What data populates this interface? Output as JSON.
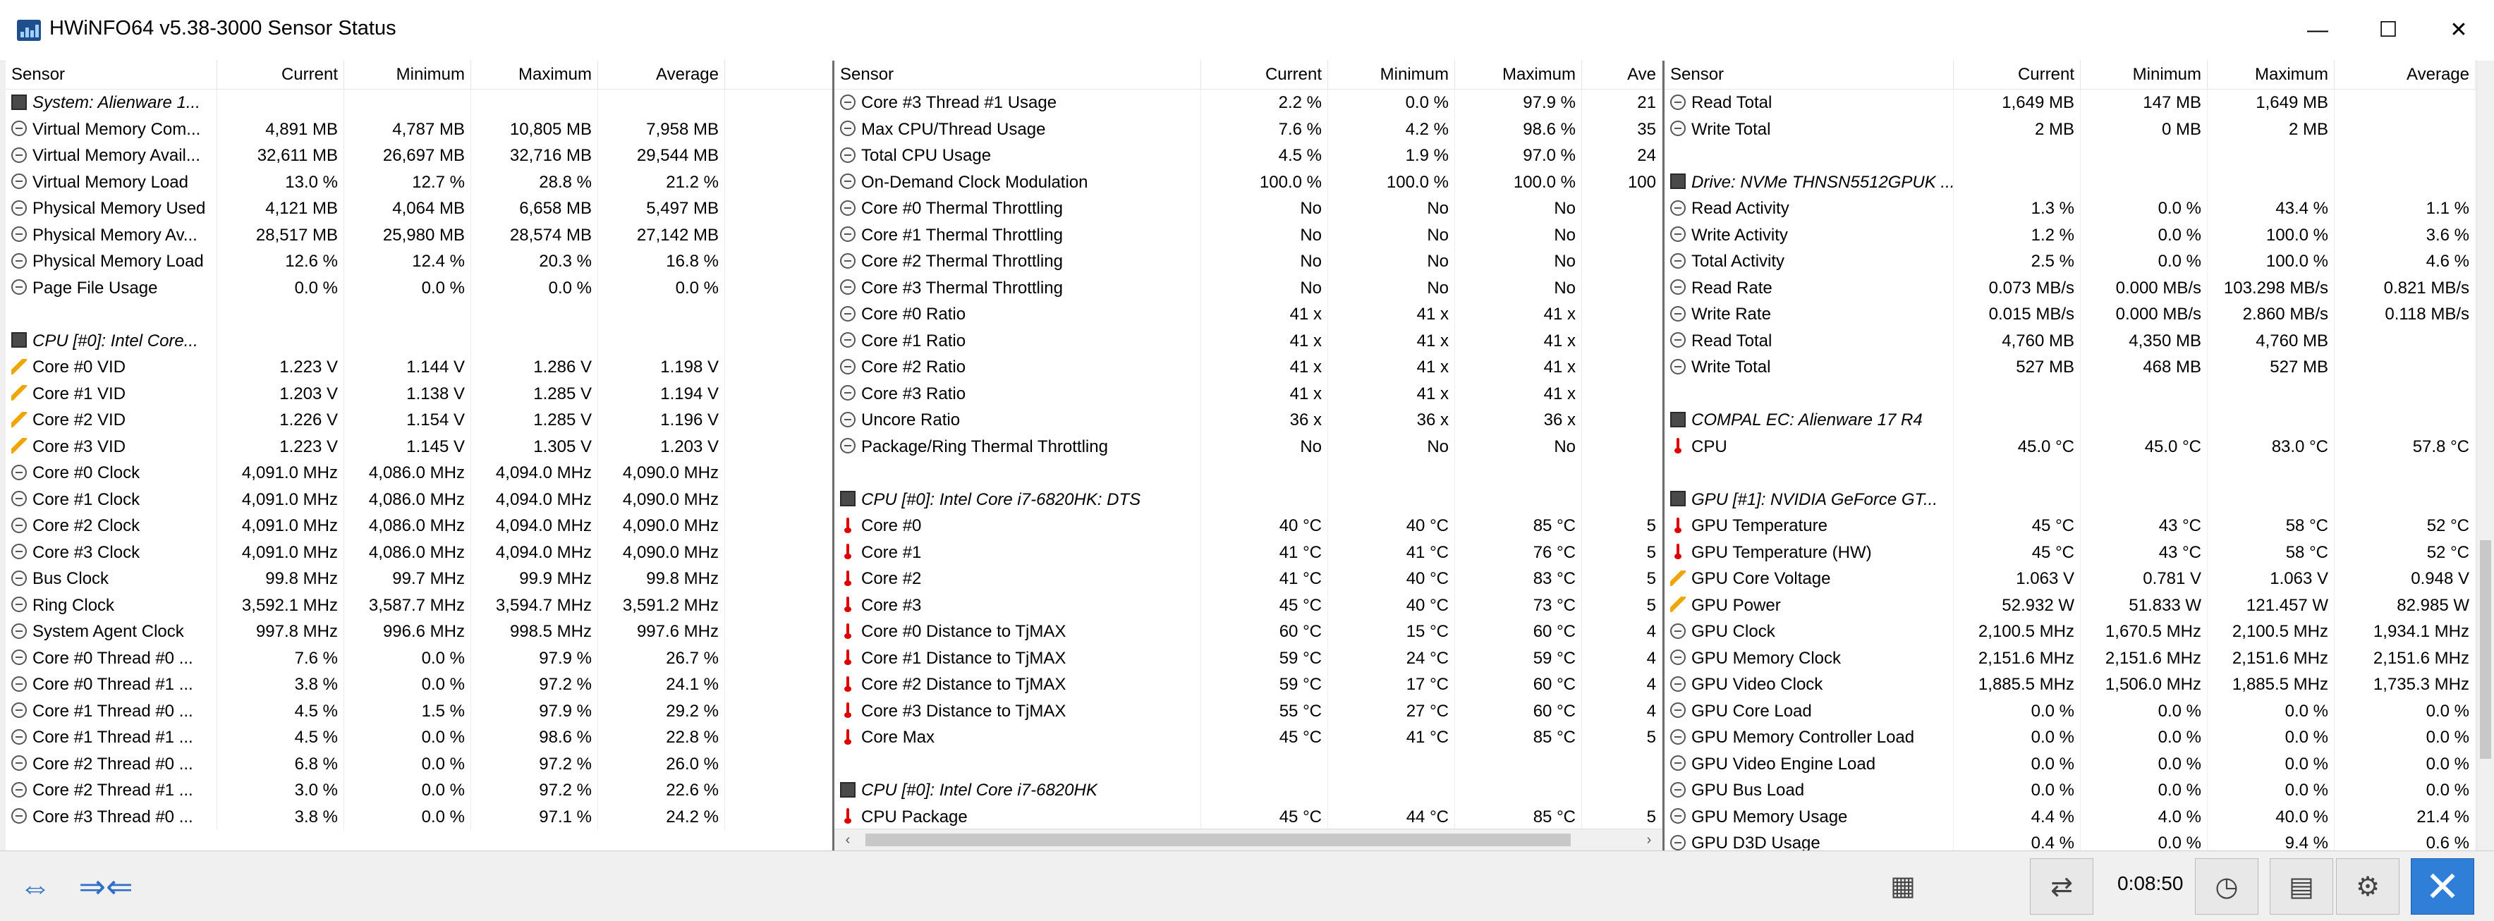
{
  "window": {
    "title": "HWiNFO64 v5.38-3000 Sensor Status",
    "min": "—",
    "max": "☐",
    "close": "✕"
  },
  "panel1": {
    "headers": [
      "Sensor",
      "Current",
      "Minimum",
      "Maximum",
      "Average"
    ],
    "rows": [
      {
        "icon": "chip",
        "name": "System: Alienware 1...",
        "group": true,
        "v": [
          "",
          "",
          "",
          ""
        ]
      },
      {
        "icon": "sensor",
        "name": "Virtual Memory Com...",
        "v": [
          "4,891 MB",
          "4,787 MB",
          "10,805 MB",
          "7,958 MB"
        ]
      },
      {
        "icon": "sensor",
        "name": "Virtual Memory Avail...",
        "v": [
          "32,611 MB",
          "26,697 MB",
          "32,716 MB",
          "29,544 MB"
        ]
      },
      {
        "icon": "sensor",
        "name": "Virtual Memory Load",
        "v": [
          "13.0 %",
          "12.7 %",
          "28.8 %",
          "21.2 %"
        ]
      },
      {
        "icon": "sensor",
        "name": "Physical Memory Used",
        "v": [
          "4,121 MB",
          "4,064 MB",
          "6,658 MB",
          "5,497 MB"
        ]
      },
      {
        "icon": "sensor",
        "name": "Physical Memory Av...",
        "v": [
          "28,517 MB",
          "25,980 MB",
          "28,574 MB",
          "27,142 MB"
        ]
      },
      {
        "icon": "sensor",
        "name": "Physical Memory Load",
        "v": [
          "12.6 %",
          "12.4 %",
          "20.3 %",
          "16.8 %"
        ]
      },
      {
        "icon": "sensor",
        "name": "Page File Usage",
        "v": [
          "0.0 %",
          "0.0 %",
          "0.0 %",
          "0.0 %"
        ]
      },
      {
        "icon": "",
        "name": "",
        "v": [
          "",
          "",
          "",
          ""
        ]
      },
      {
        "icon": "chip",
        "name": "CPU [#0]: Intel Core...",
        "group": true,
        "v": [
          "",
          "",
          "",
          ""
        ]
      },
      {
        "icon": "volt",
        "name": "Core #0 VID",
        "v": [
          "1.223 V",
          "1.144 V",
          "1.286 V",
          "1.198 V"
        ]
      },
      {
        "icon": "volt",
        "name": "Core #1 VID",
        "v": [
          "1.203 V",
          "1.138 V",
          "1.285 V",
          "1.194 V"
        ]
      },
      {
        "icon": "volt",
        "name": "Core #2 VID",
        "v": [
          "1.226 V",
          "1.154 V",
          "1.285 V",
          "1.196 V"
        ]
      },
      {
        "icon": "volt",
        "name": "Core #3 VID",
        "v": [
          "1.223 V",
          "1.145 V",
          "1.305 V",
          "1.203 V"
        ]
      },
      {
        "icon": "sensor",
        "name": "Core #0 Clock",
        "v": [
          "4,091.0 MHz",
          "4,086.0 MHz",
          "4,094.0 MHz",
          "4,090.0 MHz"
        ]
      },
      {
        "icon": "sensor",
        "name": "Core #1 Clock",
        "v": [
          "4,091.0 MHz",
          "4,086.0 MHz",
          "4,094.0 MHz",
          "4,090.0 MHz"
        ]
      },
      {
        "icon": "sensor",
        "name": "Core #2 Clock",
        "v": [
          "4,091.0 MHz",
          "4,086.0 MHz",
          "4,094.0 MHz",
          "4,090.0 MHz"
        ]
      },
      {
        "icon": "sensor",
        "name": "Core #3 Clock",
        "v": [
          "4,091.0 MHz",
          "4,086.0 MHz",
          "4,094.0 MHz",
          "4,090.0 MHz"
        ]
      },
      {
        "icon": "sensor",
        "name": "Bus Clock",
        "v": [
          "99.8 MHz",
          "99.7 MHz",
          "99.9 MHz",
          "99.8 MHz"
        ]
      },
      {
        "icon": "sensor",
        "name": "Ring Clock",
        "v": [
          "3,592.1 MHz",
          "3,587.7 MHz",
          "3,594.7 MHz",
          "3,591.2 MHz"
        ]
      },
      {
        "icon": "sensor",
        "name": "System Agent Clock",
        "v": [
          "997.8 MHz",
          "996.6 MHz",
          "998.5 MHz",
          "997.6 MHz"
        ]
      },
      {
        "icon": "sensor",
        "name": "Core #0 Thread #0 ...",
        "v": [
          "7.6 %",
          "0.0 %",
          "97.9 %",
          "26.7 %"
        ]
      },
      {
        "icon": "sensor",
        "name": "Core #0 Thread #1 ...",
        "v": [
          "3.8 %",
          "0.0 %",
          "97.2 %",
          "24.1 %"
        ]
      },
      {
        "icon": "sensor",
        "name": "Core #1 Thread #0 ...",
        "v": [
          "4.5 %",
          "1.5 %",
          "97.9 %",
          "29.2 %"
        ]
      },
      {
        "icon": "sensor",
        "name": "Core #1 Thread #1 ...",
        "v": [
          "4.5 %",
          "0.0 %",
          "98.6 %",
          "22.8 %"
        ]
      },
      {
        "icon": "sensor",
        "name": "Core #2 Thread #0 ...",
        "v": [
          "6.8 %",
          "0.0 %",
          "97.2 %",
          "26.0 %"
        ]
      },
      {
        "icon": "sensor",
        "name": "Core #2 Thread #1 ...",
        "v": [
          "3.0 %",
          "0.0 %",
          "97.2 %",
          "22.6 %"
        ]
      },
      {
        "icon": "sensor",
        "name": "Core #3 Thread #0 ...",
        "v": [
          "3.8 %",
          "0.0 %",
          "97.1 %",
          "24.2 %"
        ]
      }
    ]
  },
  "panel2": {
    "headers": [
      "Sensor",
      "Current",
      "Minimum",
      "Maximum",
      "Ave"
    ],
    "rows": [
      {
        "icon": "sensor",
        "name": "Core #3 Thread #1 Usage",
        "v": [
          "2.2 %",
          "0.0 %",
          "97.9 %",
          "21"
        ]
      },
      {
        "icon": "sensor",
        "name": "Max CPU/Thread Usage",
        "v": [
          "7.6 %",
          "4.2 %",
          "98.6 %",
          "35"
        ]
      },
      {
        "icon": "sensor",
        "name": "Total CPU Usage",
        "v": [
          "4.5 %",
          "1.9 %",
          "97.0 %",
          "24"
        ]
      },
      {
        "icon": "sensor",
        "name": "On-Demand Clock Modulation",
        "v": [
          "100.0 %",
          "100.0 %",
          "100.0 %",
          "100"
        ]
      },
      {
        "icon": "sensor",
        "name": "Core #0 Thermal Throttling",
        "v": [
          "No",
          "No",
          "No",
          ""
        ]
      },
      {
        "icon": "sensor",
        "name": "Core #1 Thermal Throttling",
        "v": [
          "No",
          "No",
          "No",
          ""
        ]
      },
      {
        "icon": "sensor",
        "name": "Core #2 Thermal Throttling",
        "v": [
          "No",
          "No",
          "No",
          ""
        ]
      },
      {
        "icon": "sensor",
        "name": "Core #3 Thermal Throttling",
        "v": [
          "No",
          "No",
          "No",
          ""
        ]
      },
      {
        "icon": "sensor",
        "name": "Core #0 Ratio",
        "v": [
          "41 x",
          "41 x",
          "41 x",
          ""
        ]
      },
      {
        "icon": "sensor",
        "name": "Core #1 Ratio",
        "v": [
          "41 x",
          "41 x",
          "41 x",
          ""
        ]
      },
      {
        "icon": "sensor",
        "name": "Core #2 Ratio",
        "v": [
          "41 x",
          "41 x",
          "41 x",
          ""
        ]
      },
      {
        "icon": "sensor",
        "name": "Core #3 Ratio",
        "v": [
          "41 x",
          "41 x",
          "41 x",
          ""
        ]
      },
      {
        "icon": "sensor",
        "name": "Uncore Ratio",
        "v": [
          "36 x",
          "36 x",
          "36 x",
          ""
        ]
      },
      {
        "icon": "sensor",
        "name": "Package/Ring Thermal Throttling",
        "v": [
          "No",
          "No",
          "No",
          ""
        ]
      },
      {
        "icon": "",
        "name": "",
        "v": [
          "",
          "",
          "",
          ""
        ]
      },
      {
        "icon": "chip",
        "name": "CPU [#0]: Intel Core i7-6820HK: DTS",
        "group": true,
        "v": [
          "",
          "",
          "",
          ""
        ]
      },
      {
        "icon": "temp",
        "name": "Core #0",
        "v": [
          "40 °C",
          "40 °C",
          "85 °C",
          "5"
        ]
      },
      {
        "icon": "temp",
        "name": "Core #1",
        "v": [
          "41 °C",
          "41 °C",
          "76 °C",
          "5"
        ]
      },
      {
        "icon": "temp",
        "name": "Core #2",
        "v": [
          "41 °C",
          "40 °C",
          "83 °C",
          "5"
        ]
      },
      {
        "icon": "temp",
        "name": "Core #3",
        "v": [
          "45 °C",
          "40 °C",
          "73 °C",
          "5"
        ]
      },
      {
        "icon": "temp",
        "name": "Core #0 Distance to TjMAX",
        "v": [
          "60 °C",
          "15 °C",
          "60 °C",
          "4"
        ]
      },
      {
        "icon": "temp",
        "name": "Core #1 Distance to TjMAX",
        "v": [
          "59 °C",
          "24 °C",
          "59 °C",
          "4"
        ]
      },
      {
        "icon": "temp",
        "name": "Core #2 Distance to TjMAX",
        "v": [
          "59 °C",
          "17 °C",
          "60 °C",
          "4"
        ]
      },
      {
        "icon": "temp",
        "name": "Core #3 Distance to TjMAX",
        "v": [
          "55 °C",
          "27 °C",
          "60 °C",
          "4"
        ]
      },
      {
        "icon": "temp",
        "name": "Core Max",
        "v": [
          "45 °C",
          "41 °C",
          "85 °C",
          "5"
        ]
      },
      {
        "icon": "",
        "name": "",
        "v": [
          "",
          "",
          "",
          ""
        ]
      },
      {
        "icon": "chip",
        "name": "CPU [#0]: Intel Core i7-6820HK",
        "group": true,
        "v": [
          "",
          "",
          "",
          ""
        ]
      },
      {
        "icon": "temp",
        "name": "CPU Package",
        "v": [
          "45 °C",
          "44 °C",
          "85 °C",
          "5"
        ]
      }
    ]
  },
  "panel3": {
    "headers": [
      "Sensor",
      "Current",
      "Minimum",
      "Maximum",
      "Average"
    ],
    "rows": [
      {
        "icon": "sensor",
        "name": "Read Total",
        "v": [
          "1,649 MB",
          "147 MB",
          "1,649 MB",
          ""
        ]
      },
      {
        "icon": "sensor",
        "name": "Write Total",
        "v": [
          "2 MB",
          "0 MB",
          "2 MB",
          ""
        ]
      },
      {
        "icon": "",
        "name": "",
        "v": [
          "",
          "",
          "",
          ""
        ]
      },
      {
        "icon": "chip",
        "name": "Drive: NVMe THNSN5512GPUK ...",
        "group": true,
        "v": [
          "",
          "",
          "",
          ""
        ]
      },
      {
        "icon": "sensor",
        "name": "Read Activity",
        "v": [
          "1.3 %",
          "0.0 %",
          "43.4 %",
          "1.1 %"
        ]
      },
      {
        "icon": "sensor",
        "name": "Write Activity",
        "v": [
          "1.2 %",
          "0.0 %",
          "100.0 %",
          "3.6 %"
        ]
      },
      {
        "icon": "sensor",
        "name": "Total Activity",
        "v": [
          "2.5 %",
          "0.0 %",
          "100.0 %",
          "4.6 %"
        ]
      },
      {
        "icon": "sensor",
        "name": "Read Rate",
        "v": [
          "0.073 MB/s",
          "0.000 MB/s",
          "103.298 MB/s",
          "0.821 MB/s"
        ]
      },
      {
        "icon": "sensor",
        "name": "Write Rate",
        "v": [
          "0.015 MB/s",
          "0.000 MB/s",
          "2.860 MB/s",
          "0.118 MB/s"
        ]
      },
      {
        "icon": "sensor",
        "name": "Read Total",
        "v": [
          "4,760 MB",
          "4,350 MB",
          "4,760 MB",
          ""
        ]
      },
      {
        "icon": "sensor",
        "name": "Write Total",
        "v": [
          "527 MB",
          "468 MB",
          "527 MB",
          ""
        ]
      },
      {
        "icon": "",
        "name": "",
        "v": [
          "",
          "",
          "",
          ""
        ]
      },
      {
        "icon": "chip",
        "name": "COMPAL EC: Alienware 17 R4",
        "group": true,
        "v": [
          "",
          "",
          "",
          ""
        ]
      },
      {
        "icon": "temp",
        "name": "CPU",
        "v": [
          "45.0 °C",
          "45.0 °C",
          "83.0 °C",
          "57.8 °C"
        ]
      },
      {
        "icon": "",
        "name": "",
        "v": [
          "",
          "",
          "",
          ""
        ]
      },
      {
        "icon": "chip",
        "name": "GPU [#1]: NVIDIA GeForce GT...",
        "group": true,
        "v": [
          "",
          "",
          "",
          ""
        ]
      },
      {
        "icon": "temp",
        "name": "GPU Temperature",
        "v": [
          "45 °C",
          "43 °C",
          "58 °C",
          "52 °C"
        ]
      },
      {
        "icon": "temp",
        "name": "GPU Temperature (HW)",
        "v": [
          "45 °C",
          "43 °C",
          "58 °C",
          "52 °C"
        ]
      },
      {
        "icon": "volt",
        "name": "GPU Core Voltage",
        "v": [
          "1.063 V",
          "0.781 V",
          "1.063 V",
          "0.948 V"
        ]
      },
      {
        "icon": "volt",
        "name": "GPU Power",
        "v": [
          "52.932 W",
          "51.833 W",
          "121.457 W",
          "82.985 W"
        ]
      },
      {
        "icon": "sensor",
        "name": "GPU Clock",
        "v": [
          "2,100.5 MHz",
          "1,670.5 MHz",
          "2,100.5 MHz",
          "1,934.1 MHz"
        ]
      },
      {
        "icon": "sensor",
        "name": "GPU Memory Clock",
        "v": [
          "2,151.6 MHz",
          "2,151.6 MHz",
          "2,151.6 MHz",
          "2,151.6 MHz"
        ]
      },
      {
        "icon": "sensor",
        "name": "GPU Video Clock",
        "v": [
          "1,885.5 MHz",
          "1,506.0 MHz",
          "1,885.5 MHz",
          "1,735.3 MHz"
        ]
      },
      {
        "icon": "sensor",
        "name": "GPU Core Load",
        "v": [
          "0.0 %",
          "0.0 %",
          "0.0 %",
          "0.0 %"
        ]
      },
      {
        "icon": "sensor",
        "name": "GPU Memory Controller Load",
        "v": [
          "0.0 %",
          "0.0 %",
          "0.0 %",
          "0.0 %"
        ]
      },
      {
        "icon": "sensor",
        "name": "GPU Video Engine Load",
        "v": [
          "0.0 %",
          "0.0 %",
          "0.0 %",
          "0.0 %"
        ]
      },
      {
        "icon": "sensor",
        "name": "GPU Bus Load",
        "v": [
          "0.0 %",
          "0.0 %",
          "0.0 %",
          "0.0 %"
        ]
      },
      {
        "icon": "sensor",
        "name": "GPU Memory Usage",
        "v": [
          "4.4 %",
          "4.0 %",
          "40.0 %",
          "21.4 %"
        ]
      },
      {
        "icon": "sensor",
        "name": "GPU D3D Usage",
        "v": [
          "0.4 %",
          "0.0 %",
          "9.4 %",
          "0.6 %"
        ]
      }
    ]
  },
  "statusbar": {
    "timer": "0:08:50",
    "nav_left": "⇔",
    "nav_right": "⇒⇐",
    "icons": [
      "network-icon",
      "clock-icon",
      "add-report-icon",
      "settings-icon",
      "close-icon"
    ]
  }
}
